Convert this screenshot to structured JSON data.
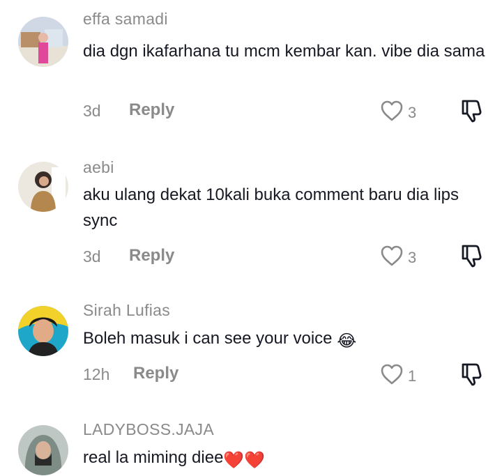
{
  "comments": [
    {
      "username": "effa samadi",
      "text": "dia dgn ikafarhana tu mcm kembar kan. vibe dia sama",
      "time": "3d",
      "reply_label": "Reply",
      "likes": "3"
    },
    {
      "username": "aebi",
      "text": "aku ulang dekat 10kali buka comment baru dia lips sync",
      "time": "3d",
      "reply_label": "Reply",
      "likes": "3"
    },
    {
      "username": "Sirah Lufias",
      "text": "Boleh masuk i can see your voice",
      "emoji": "😂",
      "time": "12h",
      "reply_label": "Reply",
      "likes": "1"
    },
    {
      "username": "LADYBOSS.JAJA",
      "text": "real la miming diee",
      "emoji": "❤️❤️"
    }
  ],
  "icons": {
    "like": "heart-outline-icon",
    "dislike": "thumbs-down-icon"
  },
  "colors": {
    "username": "#8a8a8a",
    "text": "#161823",
    "meta": "#8a8a8a",
    "emoji_heart": "#e0245e"
  }
}
